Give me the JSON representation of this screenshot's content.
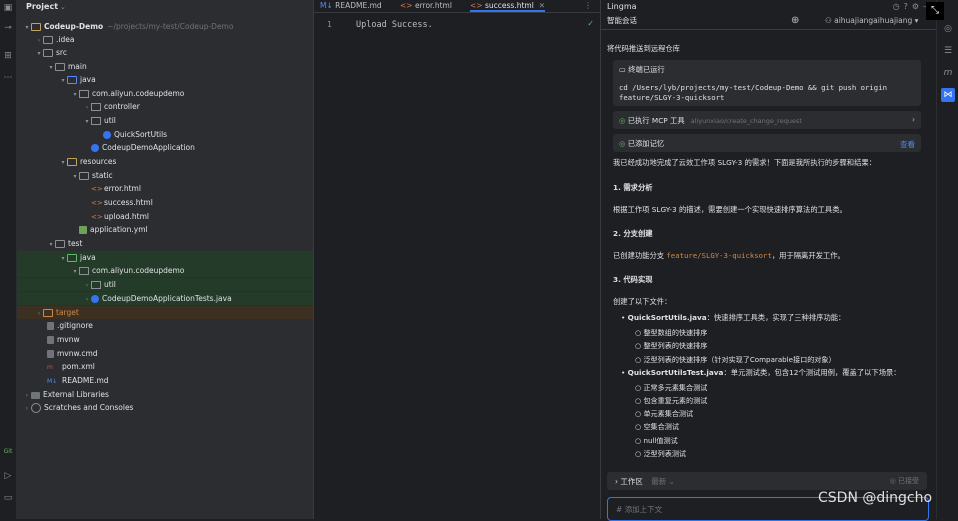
{
  "project_panel": {
    "title": "Project",
    "tree": [
      {
        "label": "Codeup-Demo",
        "path": "~/projects/my-test/Codeup-Demo",
        "icon": "module-folder-icon"
      },
      {
        "label": ".idea",
        "icon": "folder-icon"
      },
      {
        "label": "src",
        "icon": "folder-icon"
      },
      {
        "label": "main",
        "icon": "folder-icon"
      },
      {
        "label": "java",
        "icon": "source-folder-icon"
      },
      {
        "label": "com.aliyun.codeupdemo",
        "icon": "package-icon"
      },
      {
        "label": "controller",
        "icon": "package-icon"
      },
      {
        "label": "util",
        "icon": "package-icon"
      },
      {
        "label": "QuickSortUtils",
        "icon": "class-icon"
      },
      {
        "label": "CodeupDemoApplication",
        "icon": "class-icon"
      },
      {
        "label": "resources",
        "icon": "resources-folder-icon"
      },
      {
        "label": "static",
        "icon": "folder-icon"
      },
      {
        "label": "error.html",
        "icon": "html-icon"
      },
      {
        "label": "success.html",
        "icon": "html-icon"
      },
      {
        "label": "upload.html",
        "icon": "html-icon"
      },
      {
        "label": "application.yml",
        "icon": "yml-icon"
      },
      {
        "label": "test",
        "icon": "folder-icon"
      },
      {
        "label": "java",
        "icon": "test-folder-icon"
      },
      {
        "label": "com.aliyun.codeupdemo",
        "icon": "package-icon"
      },
      {
        "label": "util",
        "icon": "package-icon"
      },
      {
        "label": "CodeupDemoApplicationTests.java",
        "icon": "class-icon"
      },
      {
        "label": "target",
        "icon": "excluded-folder-icon"
      },
      {
        "label": ".gitignore",
        "icon": "file-icon"
      },
      {
        "label": "mvnw",
        "icon": "file-icon"
      },
      {
        "label": "mvnw.cmd",
        "icon": "file-icon"
      },
      {
        "label": "pom.xml",
        "icon": "maven-icon"
      },
      {
        "label": "README.md",
        "icon": "markdown-icon"
      },
      {
        "label": "External Libraries",
        "icon": "library-icon"
      },
      {
        "label": "Scratches and Consoles",
        "icon": "scratch-icon"
      }
    ]
  },
  "editor": {
    "tabs": [
      {
        "label": "README.md",
        "prefix": "M↓"
      },
      {
        "label": "error.html",
        "prefix": "<>"
      },
      {
        "label": "success.html",
        "prefix": "<>",
        "active": true
      }
    ],
    "line_number": "1",
    "code": "Upload Success."
  },
  "assistant": {
    "title": "Lingma",
    "tab": "智能会话",
    "user": "aihuajiangaihuajiang",
    "intro": "将代码推送到远程仓库",
    "terminal_card": {
      "title": "终端已运行",
      "cmd_line1": "cd /Users/lyb/projects/my-test/Codeup-Demo && git push origin",
      "cmd_line2": "feature/SLGY-3-quicksort"
    },
    "mcp_card": {
      "title": "已执行 MCP 工具",
      "sub": "aliyunxiao/create_change_request"
    },
    "memory_card": {
      "title": "已添加记忆",
      "action": "查看"
    },
    "summary": "我已经成功地完成了云效工作项 SLGY-3 的需求！下面是我所执行的步骤和结果：",
    "h1": "1. 需求分析",
    "p1": "根据工作项 SLGY-3 的描述，需要创建一个实现快速排序算法的工具类。",
    "h2": "2. 分支创建",
    "p2_prefix": "已创建功能分支",
    "p2_code": "feature/SLGY-3-quicksort",
    "p2_suffix": "，用于隔离开发工作。",
    "h3": "3. 代码实现",
    "p3": "创建了以下文件：",
    "file1_name": "QuickSortUtils.java",
    "file1_desc": "：快速排序工具类，实现了三种排序功能：",
    "file1_items": [
      "整型数组的快速排序",
      "整型列表的快速排序",
      "泛型列表的快速排序（针对实现了Comparable接口的对象）"
    ],
    "file2_name": "QuickSortUtilsTest.java",
    "file2_desc": "：单元测试类，包含12个测试用例，覆盖了以下场景：",
    "file2_items": [
      "正常多元素集合测试",
      "包含重复元素的测试",
      "单元素集合测试",
      "空集合测试",
      "null值测试",
      "泛型列表测试"
    ],
    "workbar_title": "工作区",
    "workbar_mode": "最新",
    "workbar_status": "已接受",
    "input_placeholder": "添加上下文"
  },
  "watermark": "CSDN @dingcho"
}
